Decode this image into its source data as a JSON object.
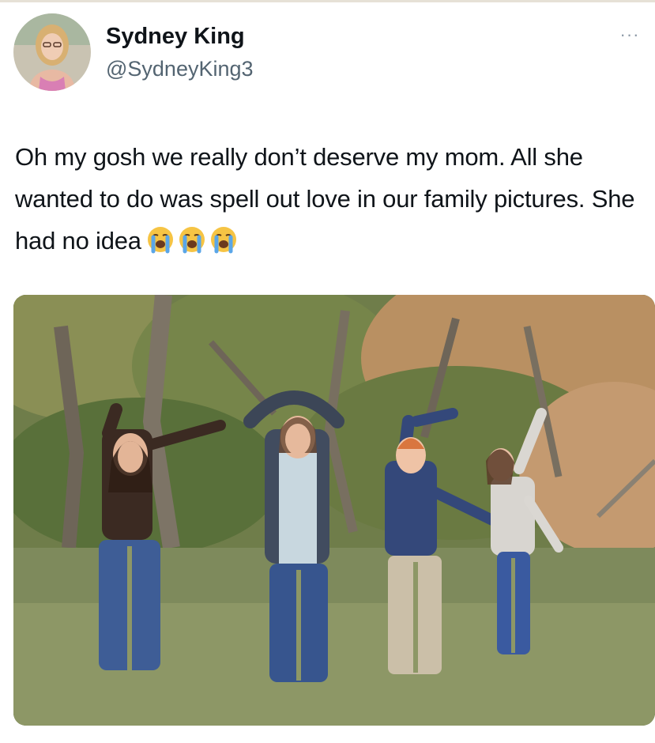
{
  "tweet": {
    "author": {
      "display_name": "Sydney King",
      "handle": "@SydneyKing3"
    },
    "more_options_label": "···",
    "text": "Oh my gosh we really don’t deserve my mom. All she wanted to do was spell out love in our family pictures. She had no idea",
    "emojis": [
      "loudly-crying-face-emoji",
      "loudly-crying-face-emoji",
      "loudly-crying-face-emoji"
    ],
    "media": {
      "type": "photo",
      "icon": "family-photo-image"
    }
  },
  "colors": {
    "text": "#0f1419",
    "secondary": "#536471",
    "background": "#ffffff"
  }
}
